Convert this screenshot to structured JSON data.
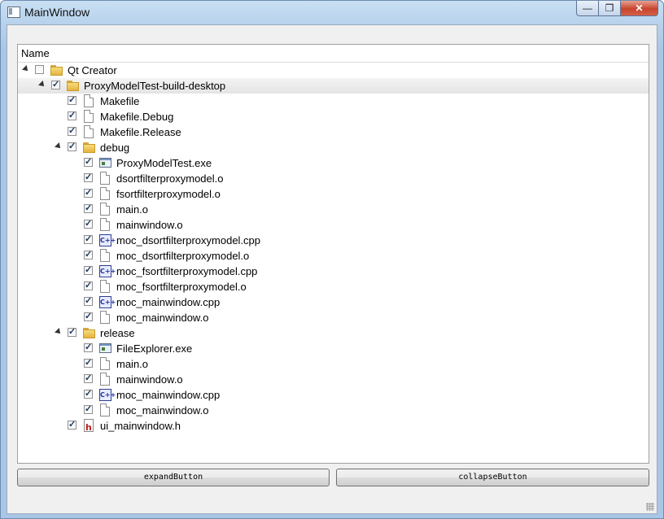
{
  "window": {
    "title": "MainWindow",
    "caption_minimize": "—",
    "caption_maximize": "❐",
    "caption_close": "✕"
  },
  "tree": {
    "header": "Name",
    "rows": [
      {
        "label": "Qt Creator",
        "depth": 0,
        "expanded": true,
        "checked": false,
        "icon": "folder-icon"
      },
      {
        "label": "ProxyModelTest-build-desktop",
        "depth": 1,
        "expanded": true,
        "checked": true,
        "icon": "folder-icon",
        "selected": true
      },
      {
        "label": "Makefile",
        "depth": 2,
        "checked": true,
        "icon": "file-icon"
      },
      {
        "label": "Makefile.Debug",
        "depth": 2,
        "checked": true,
        "icon": "file-icon"
      },
      {
        "label": "Makefile.Release",
        "depth": 2,
        "checked": true,
        "icon": "file-icon"
      },
      {
        "label": "debug",
        "depth": 2,
        "expanded": true,
        "checked": true,
        "icon": "folder-icon"
      },
      {
        "label": "ProxyModelTest.exe",
        "depth": 3,
        "checked": true,
        "icon": "exe-icon"
      },
      {
        "label": "dsortfilterproxymodel.o",
        "depth": 3,
        "checked": true,
        "icon": "file-icon"
      },
      {
        "label": "fsortfilterproxymodel.o",
        "depth": 3,
        "checked": true,
        "icon": "file-icon"
      },
      {
        "label": "main.o",
        "depth": 3,
        "checked": true,
        "icon": "file-icon"
      },
      {
        "label": "mainwindow.o",
        "depth": 3,
        "checked": true,
        "icon": "file-icon"
      },
      {
        "label": "moc_dsortfilterproxymodel.cpp",
        "depth": 3,
        "checked": true,
        "icon": "cpp-icon"
      },
      {
        "label": "moc_dsortfilterproxymodel.o",
        "depth": 3,
        "checked": true,
        "icon": "file-icon"
      },
      {
        "label": "moc_fsortfilterproxymodel.cpp",
        "depth": 3,
        "checked": true,
        "icon": "cpp-icon"
      },
      {
        "label": "moc_fsortfilterproxymodel.o",
        "depth": 3,
        "checked": true,
        "icon": "file-icon"
      },
      {
        "label": "moc_mainwindow.cpp",
        "depth": 3,
        "checked": true,
        "icon": "cpp-icon"
      },
      {
        "label": "moc_mainwindow.o",
        "depth": 3,
        "checked": true,
        "icon": "file-icon"
      },
      {
        "label": "release",
        "depth": 2,
        "expanded": true,
        "checked": true,
        "icon": "folder-icon"
      },
      {
        "label": "FileExplorer.exe",
        "depth": 3,
        "checked": true,
        "icon": "exe-icon"
      },
      {
        "label": "main.o",
        "depth": 3,
        "checked": true,
        "icon": "file-icon"
      },
      {
        "label": "mainwindow.o",
        "depth": 3,
        "checked": true,
        "icon": "file-icon"
      },
      {
        "label": "moc_mainwindow.cpp",
        "depth": 3,
        "checked": true,
        "icon": "cpp-icon"
      },
      {
        "label": "moc_mainwindow.o",
        "depth": 3,
        "checked": true,
        "icon": "file-icon"
      },
      {
        "label": "ui_mainwindow.h",
        "depth": 2,
        "checked": true,
        "icon": "header-icon"
      }
    ]
  },
  "buttons": {
    "expand": "expandButton",
    "collapse": "collapseButton"
  },
  "icon_glyphs": {
    "cpp": "C++",
    "header": "h"
  }
}
